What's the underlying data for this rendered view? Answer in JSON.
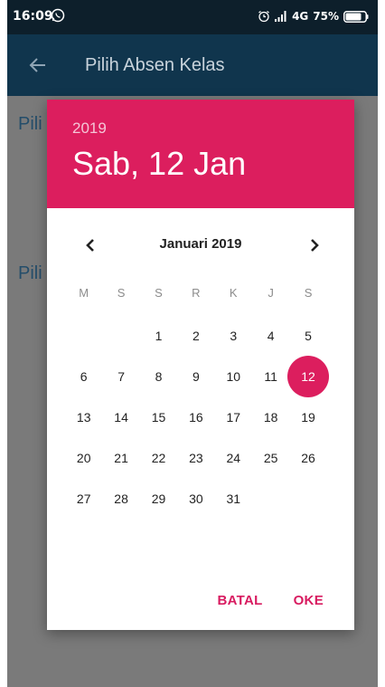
{
  "status_bar": {
    "time": "16:09",
    "network": "4G",
    "battery": "75%"
  },
  "app_bar": {
    "title": "Pilih Absen Kelas"
  },
  "background": {
    "label_1": "Pili",
    "label_2": "Pili"
  },
  "colors": {
    "accent": "#dc1e5e",
    "appbar": "#10354d",
    "statusbar": "#0d1f2b"
  },
  "date_picker": {
    "year": "2019",
    "selected_date": "Sab, 12 Jan",
    "month_label": "Januari 2019",
    "weekdays": [
      "M",
      "S",
      "S",
      "R",
      "K",
      "J",
      "S"
    ],
    "weeks": [
      [
        "",
        "",
        "1",
        "2",
        "3",
        "4",
        "5"
      ],
      [
        "6",
        "7",
        "8",
        "9",
        "10",
        "11",
        "12"
      ],
      [
        "13",
        "14",
        "15",
        "16",
        "17",
        "18",
        "19"
      ],
      [
        "20",
        "21",
        "22",
        "23",
        "24",
        "25",
        "26"
      ],
      [
        "27",
        "28",
        "29",
        "30",
        "31",
        "",
        ""
      ]
    ],
    "selected_day": "12",
    "cancel_label": "BATAL",
    "ok_label": "OKE"
  }
}
